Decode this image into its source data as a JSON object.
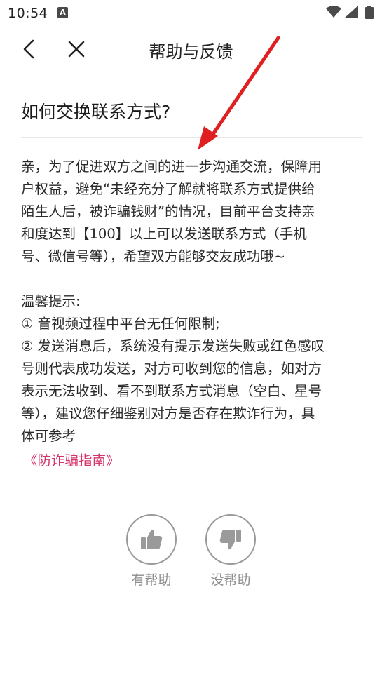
{
  "status_bar": {
    "time": "10:54",
    "notification_letter": "A"
  },
  "nav": {
    "title": "帮助与反馈"
  },
  "question": "如何交换联系方式?",
  "answer_lines": [
    "亲，为了促进双方之间的进一步沟通交流，保障用",
    "户权益，避免“未经充分了解就将联系方式提供给",
    "陌生人后，被诈骗钱财”的情况，目前平台支持亲",
    "和度达到【100】以上可以发送联系方式（手机",
    "号、微信号等），希望双方能够交友成功哦~"
  ],
  "tips_lines": [
    "温馨提示:",
    "① 音视频过程中平台无任何限制;",
    "② 发送消息后，系统没有提示发送失败或红色感叹",
    "号则代表成功发送，对方可收到您的信息，如对方",
    "表示无法收到、看不到联系方式消息（空白、星号",
    "等），建议您仔细鉴别对方是否存在欺诈行为，具",
    "体可参考"
  ],
  "guide_link": "《防诈骗指南》",
  "feedback": {
    "helpful_label": "有帮助",
    "unhelpful_label": "没帮助"
  },
  "colors": {
    "link": "#d6336c",
    "arrow": "#e02020",
    "icon_gray": "#9a9a9a"
  }
}
